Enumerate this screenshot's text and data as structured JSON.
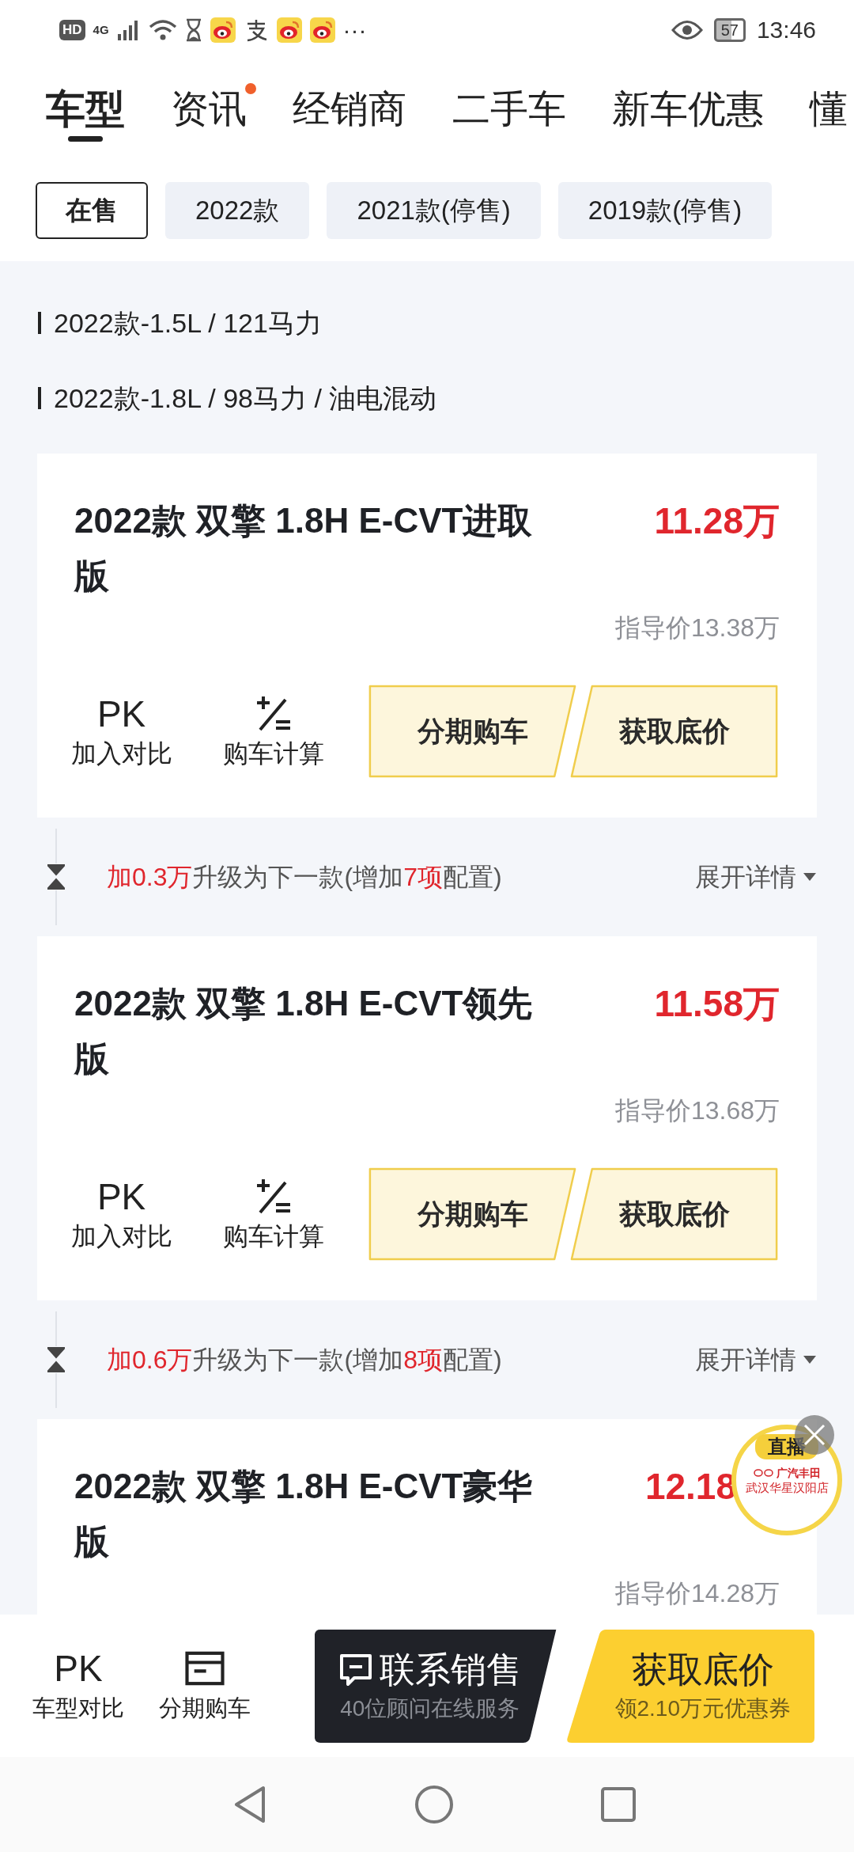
{
  "status_bar": {
    "hd": "HD",
    "network": "4G",
    "more": "···",
    "battery": "57",
    "time": "13:46"
  },
  "tabs": [
    {
      "label": "车型",
      "selected": true,
      "dot": false
    },
    {
      "label": "资讯",
      "selected": false,
      "dot": true
    },
    {
      "label": "经销商",
      "selected": false,
      "dot": false
    },
    {
      "label": "二手车",
      "selected": false,
      "dot": false
    },
    {
      "label": "新车优惠",
      "selected": false,
      "dot": false
    },
    {
      "label": "懂",
      "selected": false,
      "dot": false
    }
  ],
  "chips": [
    {
      "label": "在售",
      "selected": true
    },
    {
      "label": "2022款",
      "selected": false
    },
    {
      "label": "2021款(停售)",
      "selected": false
    },
    {
      "label": "2019款(停售)",
      "selected": false
    }
  ],
  "spec_groups": [
    "2022款-1.5L / 121马力",
    "2022款-1.8L / 98马力 / 油电混动"
  ],
  "items": [
    {
      "kind": "card",
      "title": "2022款 双擎 1.8H E-CVT进取版",
      "price": "11.28万",
      "guide_price": "指导价13.38万",
      "actions": [
        {
          "kind": "pk",
          "icon_text": "PK",
          "label": "加入对比"
        },
        {
          "kind": "calculator",
          "label": "购车计算"
        }
      ],
      "buttons": [
        "分期购车",
        "获取底价"
      ]
    },
    {
      "kind": "upgrade",
      "parts": [
        {
          "text": "加0.3万",
          "highlight": true
        },
        {
          "text": "升级为下一款(增加",
          "highlight": false
        },
        {
          "text": "7项",
          "highlight": true
        },
        {
          "text": "配置)",
          "highlight": false
        }
      ],
      "link": "展开详情"
    },
    {
      "kind": "card",
      "title": "2022款 双擎 1.8H E-CVT领先版",
      "price": "11.58万",
      "guide_price": "指导价13.68万",
      "actions": [
        {
          "kind": "pk",
          "icon_text": "PK",
          "label": "加入对比"
        },
        {
          "kind": "calculator",
          "label": "购车计算"
        }
      ],
      "buttons": [
        "分期购车",
        "获取底价"
      ]
    },
    {
      "kind": "upgrade",
      "parts": [
        {
          "text": "加0.6万",
          "highlight": true
        },
        {
          "text": "升级为下一款(增加",
          "highlight": false
        },
        {
          "text": "8项",
          "highlight": true
        },
        {
          "text": "配置)",
          "highlight": false
        }
      ],
      "link": "展开详情"
    },
    {
      "kind": "card",
      "title": "2022款 双擎 1.8H E-CVT豪华版",
      "price": "12.18",
      "guide_price": "指导价14.28万"
    }
  ],
  "live_badge": {
    "title": "直播",
    "brand": "广汽丰田",
    "store": "武汉华星汉阳店"
  },
  "bottom_bar": {
    "tools": [
      {
        "kind": "pk",
        "icon_text": "PK",
        "label": "车型对比"
      },
      {
        "kind": "card",
        "label": "分期购车"
      }
    ],
    "contact": {
      "title": "联系销售",
      "subtitle": "40位顾问在线服务"
    },
    "quote": {
      "title": "获取底价",
      "subtitle": "领2.10万元优惠券"
    }
  }
}
